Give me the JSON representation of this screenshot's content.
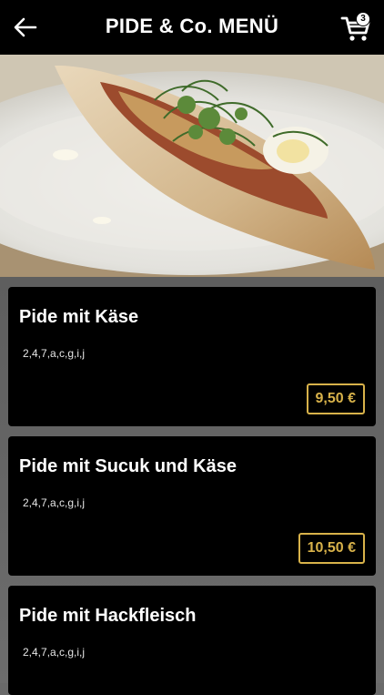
{
  "header": {
    "title": "PIDE & Co. MENÜ",
    "cart_count": "3"
  },
  "hero": {
    "image_icon": "pide-photo"
  },
  "items": [
    {
      "name": "Pide mit Käse",
      "allergens": "2,4,7,a,c,g,i,j",
      "price": "9,50 €"
    },
    {
      "name": "Pide mit Sucuk und Käse",
      "allergens": "2,4,7,a,c,g,i,j",
      "price": "10,50 €"
    },
    {
      "name": "Pide mit Hackfleisch",
      "allergens": "2,4,7,a,c,g,i,j",
      "price": ""
    }
  ],
  "colors": {
    "accent": "#d8b24a",
    "background": "#000000",
    "page": "#6a6a6a"
  }
}
